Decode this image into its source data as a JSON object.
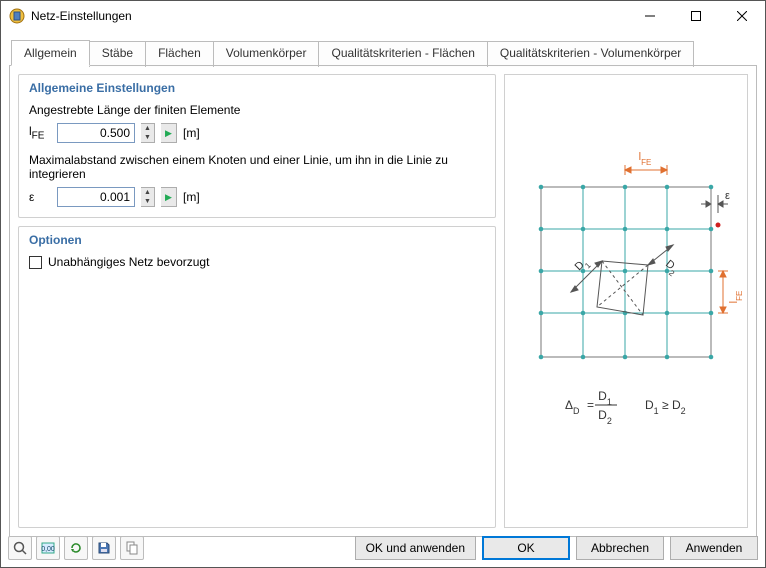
{
  "window": {
    "title": "Netz-Einstellungen"
  },
  "tabs": {
    "t0": "Allgemein",
    "t1": "Stäbe",
    "t2": "Flächen",
    "t3": "Volumenkörper",
    "t4": "Qualitätskriterien - Flächen",
    "t5": "Qualitätskriterien - Volumenkörper"
  },
  "general": {
    "group_title": "Allgemeine Einstellungen",
    "label1": "Angestrebte Länge der finiten Elemente",
    "sym1": "lFE",
    "val1": "0.500",
    "unit1": "[m]",
    "label2": "Maximalabstand zwischen einem Knoten und einer Linie, um ihn in die Linie zu integrieren",
    "sym2": "ε",
    "val2": "0.001",
    "unit2": "[m]"
  },
  "options": {
    "group_title": "Optionen",
    "chk1": "Unabhängiges Netz bevorzugt"
  },
  "diagram": {
    "lfe_top": "lFE",
    "lfe_right": "lFE",
    "eps": "ε",
    "d1": "D1",
    "d2": "D2",
    "eq_lhs": "ΔD",
    "eq_eq": "=",
    "eq_num": "D1",
    "eq_den": "D2",
    "eq_cond": "D1 ≥ D2"
  },
  "footer": {
    "ok_apply": "OK und anwenden",
    "ok": "OK",
    "cancel": "Abbrechen",
    "apply": "Anwenden"
  }
}
